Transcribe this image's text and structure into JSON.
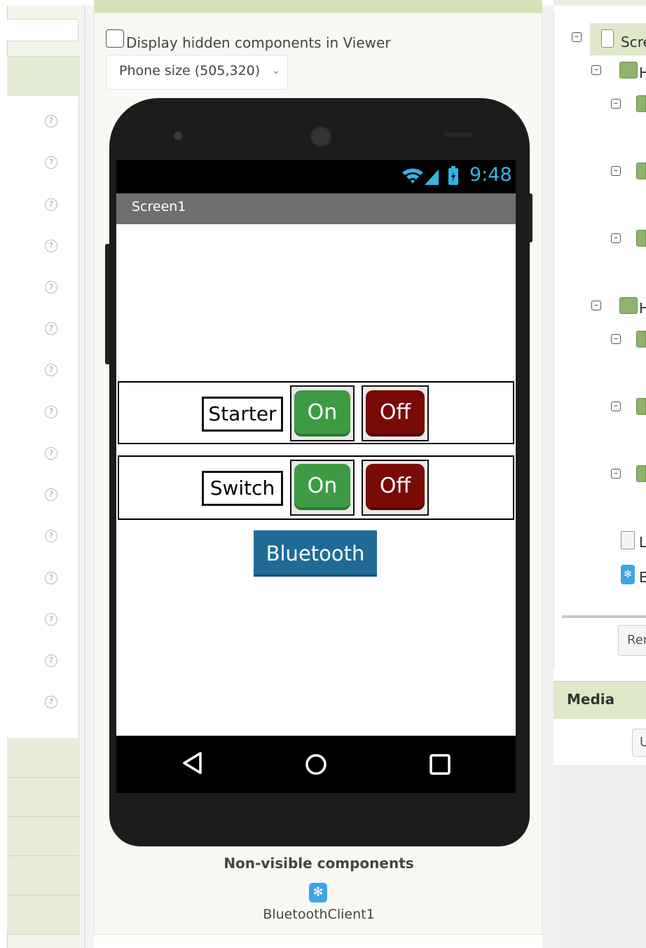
{
  "viewer": {
    "hidden_components_label": "Display hidden components in Viewer",
    "hidden_components_checked": false,
    "phone_size": "Phone size (505,320)"
  },
  "phone": {
    "status_time": "9:48",
    "screen_title": "Screen1",
    "rows": [
      {
        "label": "Starter",
        "on_label": "On",
        "off_label": "Off"
      },
      {
        "label": "Switch",
        "on_label": "On",
        "off_label": "Off"
      }
    ],
    "bluetooth_label": "Bluetooth",
    "colors": {
      "on": "#3e9b43",
      "off": "#7a0a06",
      "bluetooth": "#1f6b96",
      "status": "#33b5e5"
    }
  },
  "non_visible": {
    "title": "Non-visible components",
    "items": [
      {
        "name": "BluetoothClient1",
        "icon": "bluetooth-icon"
      }
    ]
  },
  "components_panel": {
    "root_label": "Scre",
    "partial_labels": [
      "H",
      "H",
      "L",
      "E"
    ],
    "rename_label": "Ren"
  },
  "media": {
    "title": "Media",
    "upload_label": "U"
  },
  "palette": {
    "help_icon_glyph": "?"
  }
}
